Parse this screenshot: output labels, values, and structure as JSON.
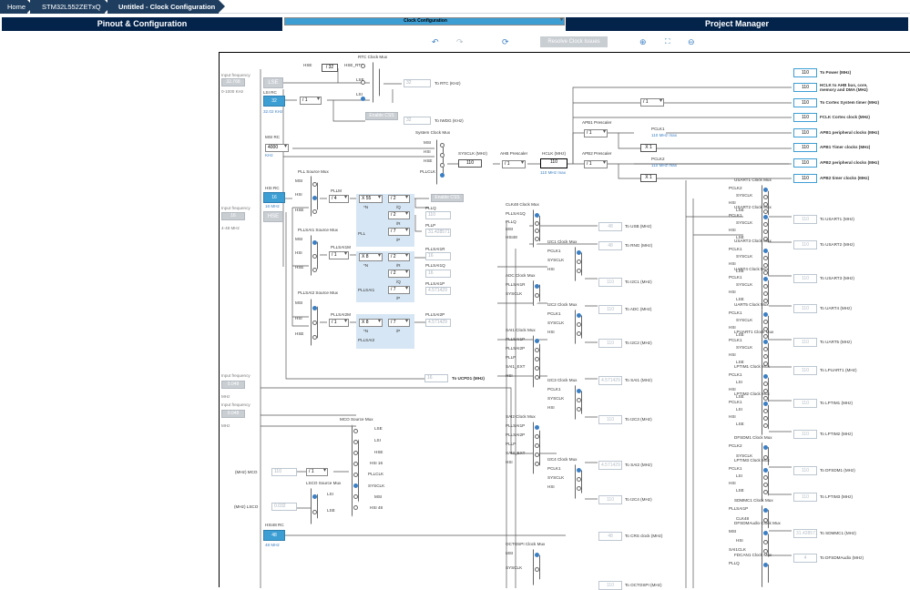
{
  "breadcrumbs": [
    "Home",
    "STM32L552ZETxQ",
    "Untitled - Clock Configuration"
  ],
  "tabs": [
    "Pinout & Configuration",
    "Clock Configuration",
    "Project Manager"
  ],
  "toolbar": {
    "resolve": "Resolve Clock Issues"
  },
  "left": {
    "input_frequency": "Input frequency",
    "lse_value": "32.768",
    "lse_range": "0-1000 KHz",
    "lse_label": "LSE",
    "lsi_rc": "LSI RC",
    "lsi_value": "32",
    "lsi_freq": "32.02 KHz",
    "msi_rc": "MSI RC",
    "msi_value": "4000",
    "msi_unit": "KHz",
    "hsi_rc": "HSI RC",
    "hsi_value": "16",
    "hsi_freq": "16 MHz",
    "hse_in_value": "16",
    "hse_range": "4-48 MHz",
    "hse_label": "HSE",
    "in2_value": "0.048",
    "in2_unit": "MHz",
    "in3_value": "0.048",
    "in3_unit": "MHz",
    "hsi48_rc": "HSI48 RC",
    "hsi48_value": "48",
    "hsi48_freq": "48 MHz"
  },
  "rtc": {
    "title": "RTC Clock Mux",
    "hse": "HSE",
    "div32": "/ 32",
    "hse_rtc": "HSE_RTC",
    "lse": "LSE",
    "lsi": "LSI",
    "rtc_val": "32",
    "rtc_lbl": "To RTC (KHz)",
    "enable_css": "Enable CSS",
    "iwdg_val": "32",
    "iwdg_lbl": "To IWDG (KHz)",
    "lsi_div": "/ 1"
  },
  "sys": {
    "title": "System Clock Mux",
    "msi": "MSI",
    "hsi": "HSI",
    "hse": "HSE",
    "pllclk": "PLLCLK",
    "sysclk_lbl": "SYSCLK (MHz)",
    "sysclk": "110",
    "ahb_lbl": "AHB Prescaler",
    "ahb": "/ 1",
    "hclk_lbl": "HCLK (MHz)",
    "hclk": "110",
    "hclk_max": "110 MHz max",
    "enable_css": "Enable CSS",
    "apb1_lbl": "APB1 Prescaler",
    "apb1": "/ 1",
    "pclk1": "PCLK1",
    "pclk1_max": "110 MHz max",
    "x1a": "X 1",
    "apb2_lbl": "APB2 Prescaler",
    "apb2": "/ 1",
    "pclk2": "PCLK2",
    "pclk2_max": "110 MHz max",
    "x1b": "X 1",
    "sys_div": "/ 1"
  },
  "outputs": [
    {
      "v": "110",
      "l": "To Power (MHz)"
    },
    {
      "v": "110",
      "l": "HCLK to AHB bus, core, memory and DMA (MHz)"
    },
    {
      "v": "110",
      "l": "To Cortex System timer (MHz)"
    },
    {
      "v": "110",
      "l": "FCLK Cortex clock (MHz)"
    },
    {
      "v": "110",
      "l": "APB1 peripheral clocks (MHz)"
    },
    {
      "v": "110",
      "l": "APB1 Timer clocks (MHz)"
    },
    {
      "v": "110",
      "l": "APB2 peripheral clocks (MHz)"
    },
    {
      "v": "110",
      "l": "APB2 timer clocks (MHz)"
    }
  ],
  "pll": {
    "title": "PLL Source Mux",
    "msi": "MSI",
    "hsi": "HSI",
    "hse": "HSE",
    "pllm": "PLLM",
    "m": "/ 4",
    "n": "X 55",
    "nl": "*N",
    "q": "/ 2",
    "ql": "/Q",
    "p": "/ 2",
    "pl": "/R",
    "r": "/ 7",
    "rl": "/P",
    "pll": "PLL",
    "pllq": "PLLQ",
    "pllq_v": "110",
    "pllp": "PLLP",
    "pllp_v": "31.428571"
  },
  "sai1": {
    "title": "PLLSAI1 Source Mux",
    "msi": "MSI",
    "hsi": "HSI",
    "hse": "HSE",
    "m_lbl": "PLLSAI1M",
    "m": "/ 1",
    "n": "X 8",
    "nl": "*N",
    "r": "/ 2",
    "rl": "/R",
    "q": "/ 2",
    "ql": "/Q",
    "p": "/ 7",
    "pl": "/P",
    "name": "PLLSAI1",
    "r_lbl": "PLLSAI1R",
    "r_v": "16",
    "q_lbl": "PLLSAI1Q",
    "q_v": "16",
    "p_lbl": "PLLSAI1P",
    "p_v": "4.571429"
  },
  "sai2": {
    "title": "PLLSAI2 Source Mux",
    "msi": "MSI",
    "hsi": "HSI",
    "hse": "HSE",
    "m_lbl": "PLLSAI2M",
    "m": "/ 1",
    "n": "X 8",
    "nl": "*N",
    "p": "/ 7",
    "pl": "/P",
    "name": "PLLSAI2",
    "p_lbl": "PLLSAI2P",
    "p_v": "4.571429"
  },
  "ucpd": {
    "v": "16",
    "l": "To UCPD1 (MHz)"
  },
  "mco": {
    "title": "MCO Source Mux",
    "items": [
      "LSE",
      "LSI",
      "HSE",
      "HSI 16",
      "PLLCLK",
      "SYSCLK",
      "MSI",
      "HSI 48"
    ],
    "div": "/ 1",
    "val": "110",
    "lbl": "(MHz) MCO"
  },
  "lsco": {
    "title": "LSCO Source Mux",
    "lsi": "LSI",
    "lse": "LSE",
    "val": "0.032",
    "lbl": "(MHz) LSCO"
  },
  "mid": {
    "clk48": {
      "title": "CLK48 Clock Mux",
      "in": [
        "PLLSAI1Q",
        "PLLQ",
        "MSI",
        "HSI48"
      ],
      "usb": "48",
      "usb_l": "To USB (MHz)",
      "rng": "48",
      "rng_l": "To RNG (MHz)"
    },
    "i2c1": {
      "title": "I2C1 Clock Mux",
      "in": [
        "PCLK1",
        "SYSCLK",
        "HSI"
      ],
      "v": "110",
      "l": "To I2C1 (MHz)"
    },
    "adc": {
      "title": "ADC Clock Mux",
      "in": [
        "PLLSAI1R",
        "SYSCLK"
      ],
      "v": "110",
      "l": "To ADC (MHz)"
    },
    "i2c2": {
      "title": "I2C2 Clock Mux",
      "in": [
        "PCLK1",
        "SYSCLK",
        "HSI"
      ],
      "v": "110",
      "l": "To I2C2 (MHz)"
    },
    "sai1": {
      "title": "SAI1 Clock Mux",
      "in": [
        "PLLSAI1P",
        "PLLSAI2P",
        "PLLP",
        "SAI1_EXT",
        "HSI"
      ],
      "v": "4.571429",
      "l": "To SAI1 (MHz)"
    },
    "i2c3": {
      "title": "I2C3 Clock Mux",
      "in": [
        "PCLK1",
        "SYSCLK",
        "HSI"
      ],
      "v": "110",
      "l": "To I2C3 (MHz)"
    },
    "sai2": {
      "title": "SAI2 Clock Mux",
      "in": [
        "PLLSAI1P",
        "PLLSAI2P",
        "PLLP",
        "SAI2_EXT",
        "HSI"
      ],
      "v": "4.571429",
      "l": "To SAI2 (MHz)"
    },
    "i2c4": {
      "title": "I2C4 Clock Mux",
      "in": [
        "PCLK1",
        "SYSCLK",
        "HSI"
      ],
      "v": "110",
      "l": "To I2C4 (MHz)"
    },
    "crs": {
      "v": "48",
      "l": "To CRS clock (MHz)"
    },
    "octo": {
      "title": "OCTOSPI Clock Mux",
      "in": [
        "MSI",
        "SYSCLK"
      ],
      "v": "110",
      "l": "To OCTOSPI (MHz)"
    }
  },
  "right": [
    {
      "title": "USART1 Clock Mux",
      "in": [
        "PCLK2",
        "SYSCLK",
        "HSI",
        "LSE"
      ],
      "v": "110",
      "l": "To USART1 (MHz)"
    },
    {
      "title": "USART2 Clock Mux",
      "in": [
        "PCLK1",
        "SYSCLK",
        "HSI",
        "LSE"
      ],
      "v": "110",
      "l": "To USART2 (MHz)"
    },
    {
      "title": "USART3 Clock Mux",
      "in": [
        "PCLK1",
        "SYSCLK",
        "HSI",
        "LSE"
      ],
      "v": "110",
      "l": "To USART3 (MHz)"
    },
    {
      "title": "UART4 Clock Mux",
      "in": [
        "PCLK1",
        "SYSCLK",
        "HSI",
        "LSE"
      ],
      "v": "110",
      "l": "To UART4 (MHz)"
    },
    {
      "title": "UART5 Clock Mux",
      "in": [
        "PCLK1",
        "SYSCLK",
        "HSI",
        "LSE"
      ],
      "v": "110",
      "l": "To UART5 (MHz)"
    },
    {
      "title": "LPUART1 Clock Mux",
      "in": [
        "PCLK1",
        "SYSCLK",
        "HSI",
        "LSE"
      ],
      "v": "110",
      "l": "To LPUART1 (MHz)"
    },
    {
      "title": "LPTIM1 Clock Mux",
      "in": [
        "PCLK1",
        "LSI",
        "HSI",
        "LSE"
      ],
      "v": "110",
      "l": "To LPTIM1 (MHz)"
    },
    {
      "title": "LPTIM2 Clock Mux",
      "in": [
        "PCLK1",
        "LSI",
        "HSI",
        "LSE"
      ],
      "v": "110",
      "l": "To LPTIM2 (MHz)"
    },
    {
      "title": "DFSDM1 Clock Mux",
      "in": [
        "PCLK2",
        "SYSCLK"
      ],
      "v": "110",
      "l": "To DFSDM1 (MHz)"
    },
    {
      "title": "LPTIM3 Clock Mux",
      "in": [
        "PCLK1",
        "LSI",
        "HSI",
        "LSE"
      ],
      "v": "110",
      "l": "To LPTIM3 (MHz)"
    },
    {
      "title": "SDMMC1 Clock Mux",
      "in": [
        "PLLSAI1P",
        "CLK48"
      ],
      "v": "31.428571",
      "l": "To SDMMC1 (MHz)"
    },
    {
      "title": "DFSDMAudio Clock Mux",
      "in": [
        "MSI",
        "HSI",
        "SAI1CLK"
      ],
      "v": "4",
      "l": "To DFSDMAudio (MHz)"
    },
    {
      "title": "FDCAN1 Clock Mux",
      "in": [
        "PLLQ"
      ],
      "v": "",
      "l": ""
    }
  ]
}
